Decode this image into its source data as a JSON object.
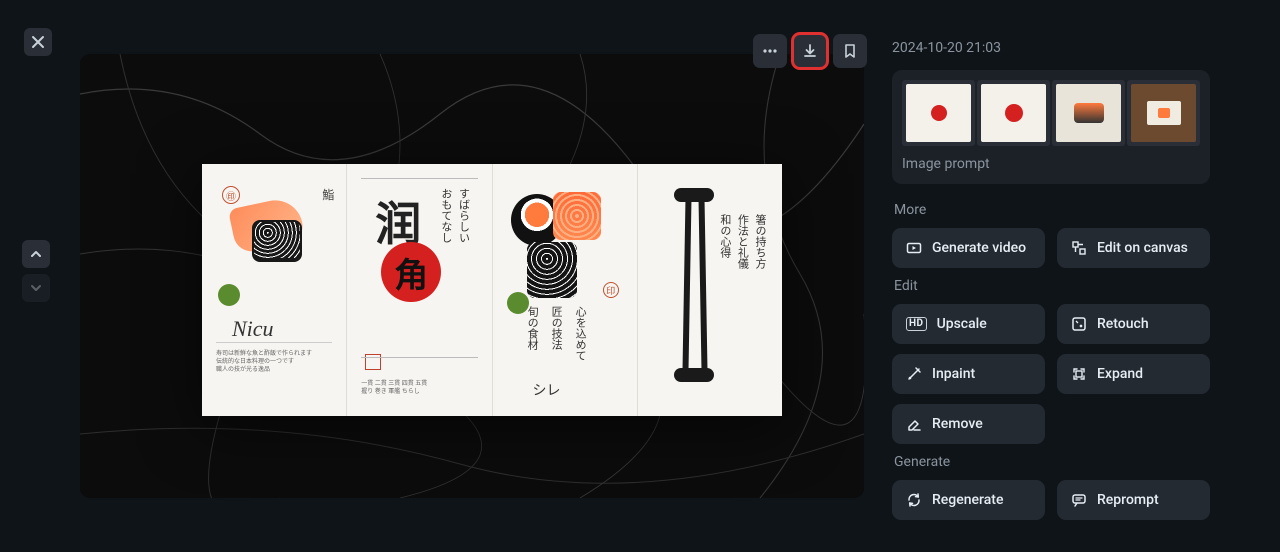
{
  "timestamp": "2024-10-20 21:03",
  "prompt_label": "Image prompt",
  "sections": {
    "more": "More",
    "edit": "Edit",
    "generate": "Generate"
  },
  "actions": {
    "generate_video": "Generate video",
    "edit_on_canvas": "Edit on canvas",
    "upscale": "Upscale",
    "retouch": "Retouch",
    "inpaint": "Inpaint",
    "expand": "Expand",
    "remove": "Remove",
    "regenerate": "Regenerate",
    "reprompt": "Reprompt"
  },
  "menu_mock": {
    "page1_title": "Nicu",
    "page2_big_char": "润",
    "page2_circle_char": "角"
  },
  "highlighted_action": "download"
}
